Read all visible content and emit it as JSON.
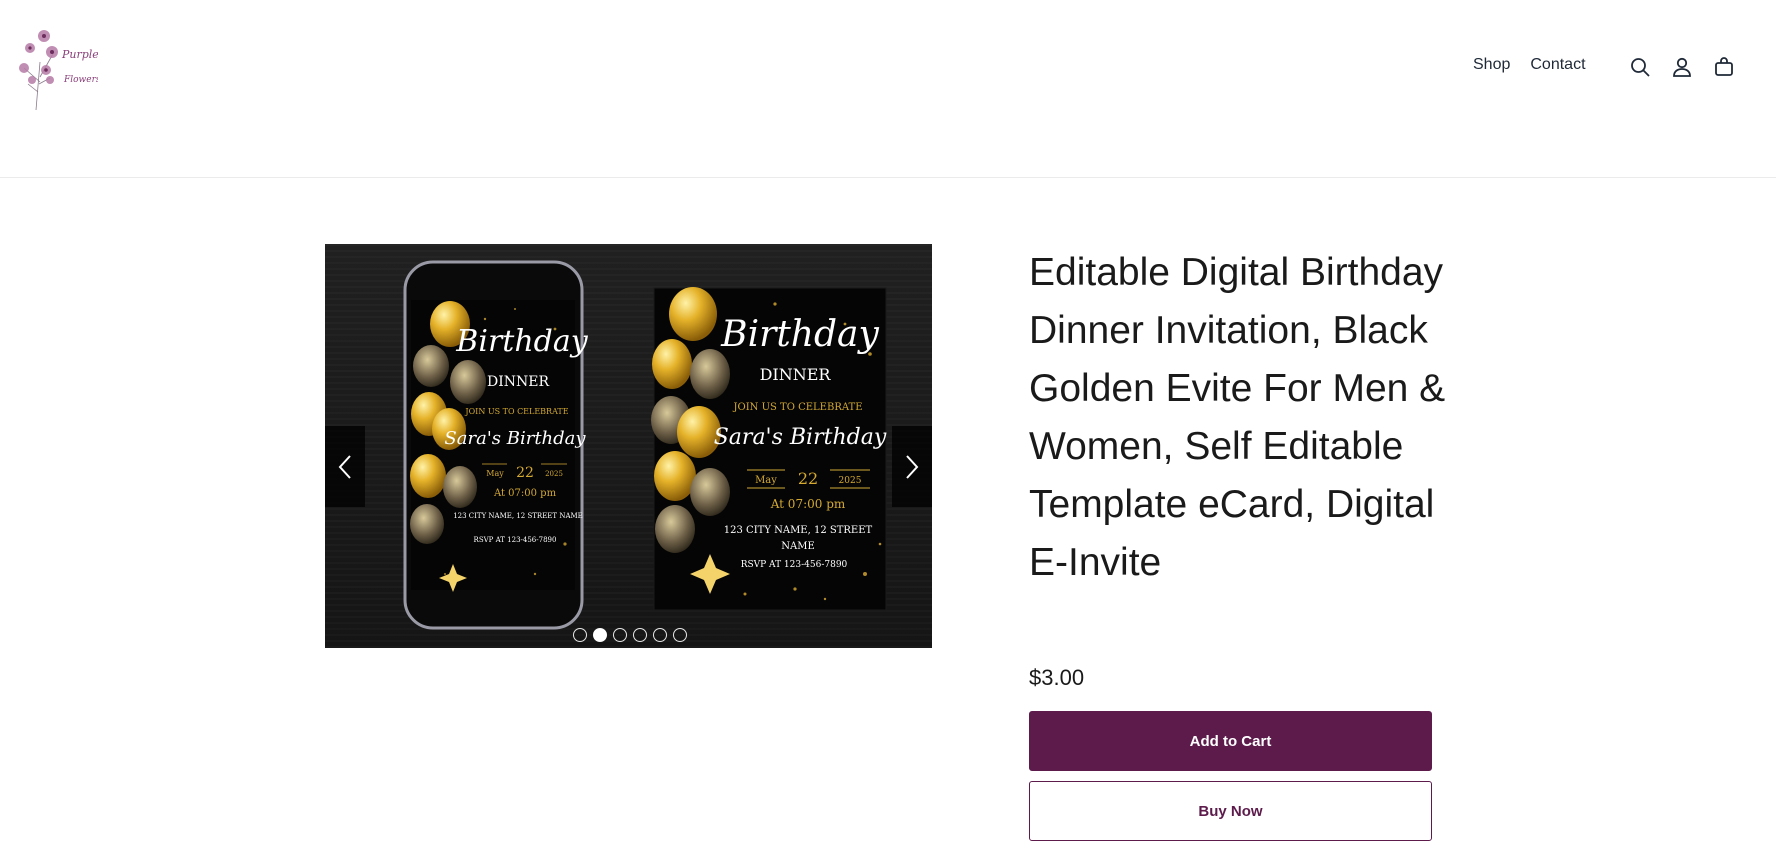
{
  "brand": {
    "logo_icon": "purple-flowers-logo",
    "accent": "#5d1b4c"
  },
  "nav": {
    "shop": "Shop",
    "contact": "Contact"
  },
  "header_icons": [
    "search-icon",
    "account-icon",
    "cart-icon"
  ],
  "gallery": {
    "slide_count": 6,
    "active_index": 1,
    "phone_card": {
      "heading": "Birthday",
      "sub": "DINNER",
      "join": "JOIN US TO CELEBRATE",
      "name": "Sara's Birthday",
      "month": "May",
      "day": "22",
      "year": "2025",
      "time": "At 07:00 pm",
      "address": "123 CITY NAME, 12 STREET NAME",
      "rsvp": "RSVP AT   123-456-7890"
    },
    "print_card": {
      "heading": "Birthday",
      "sub": "DINNER",
      "join": "JOIN US TO CELEBRATE",
      "name": "Sara's Birthday",
      "month": "May",
      "day": "22",
      "year": "2025",
      "time": "At 07:00 pm",
      "address_line1": "123 CITY NAME, 12 STREET",
      "address_line2": "NAME",
      "rsvp": "RSVP AT   123-456-7890"
    }
  },
  "product": {
    "title": "Editable Digital Birthday Dinner Invitation, Black Golden Evite For Men & Women, Self Editable Template eCard, Digital E-Invite",
    "price": "$3.00",
    "add_to_cart": "Add to Cart",
    "buy_now": "Buy Now"
  }
}
